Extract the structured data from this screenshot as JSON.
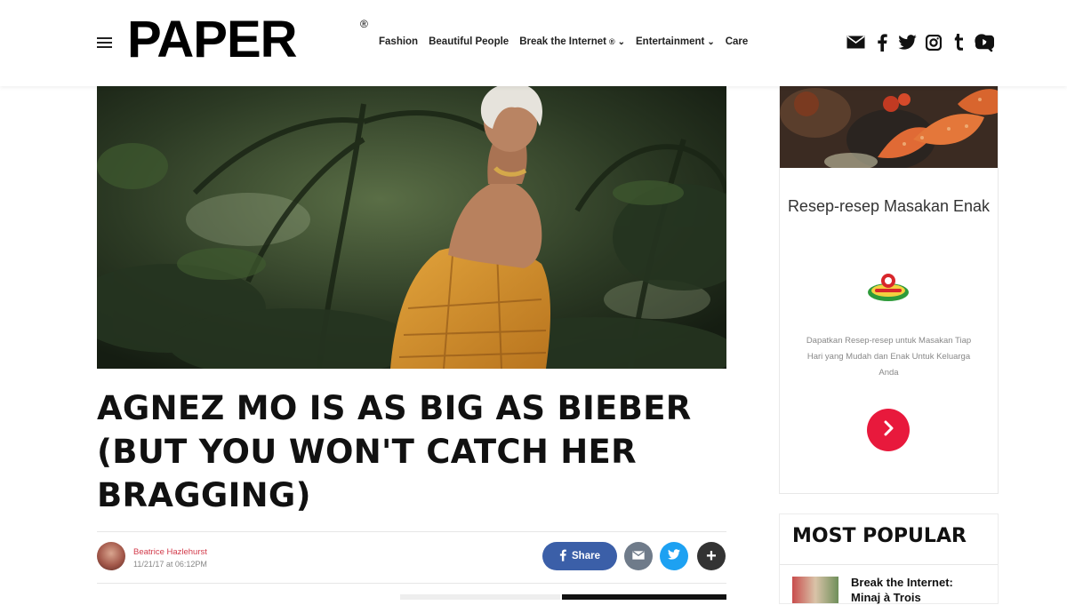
{
  "header": {
    "logo": "PAPER",
    "logo_mark": "®",
    "nav": [
      {
        "label": "Fashion",
        "dropdown": false
      },
      {
        "label": "Beautiful People",
        "dropdown": false
      },
      {
        "label": "Break the Internet",
        "dropdown": true
      },
      {
        "label": "Entertainment",
        "dropdown": true
      },
      {
        "label": "Care",
        "dropdown": false
      }
    ],
    "social_icons": [
      "mail-icon",
      "facebook-icon",
      "twitter-icon",
      "instagram-icon",
      "tumblr-icon",
      "youtube-icon"
    ],
    "search_icon": "search-icon"
  },
  "article": {
    "headline": "AGNEZ MO IS AS BIG AS BIEBER (BUT YOU WON'T CATCH HER BRAGGING)",
    "author": "Beatrice Hazlehurst",
    "date": "11/21/17 at 06:12PM",
    "share_label": "Share"
  },
  "sidebar_ad": {
    "title": "Resep-resep Masakan Enak",
    "description": "Dapatkan Resep-resep untuk Masakan Tiap Hari yang Mudah dan Enak Untuk Keluarga Anda",
    "cta_icon": "chevron-right-icon"
  },
  "most_popular": {
    "title": "MOST POPULAR",
    "items": [
      "Break the Internet: Minaj à Trois"
    ]
  },
  "colors": {
    "author_link": "#d23a4a",
    "facebook": "#3b5fa8",
    "twitter": "#1da1f2",
    "ad_button": "#e8193c"
  }
}
